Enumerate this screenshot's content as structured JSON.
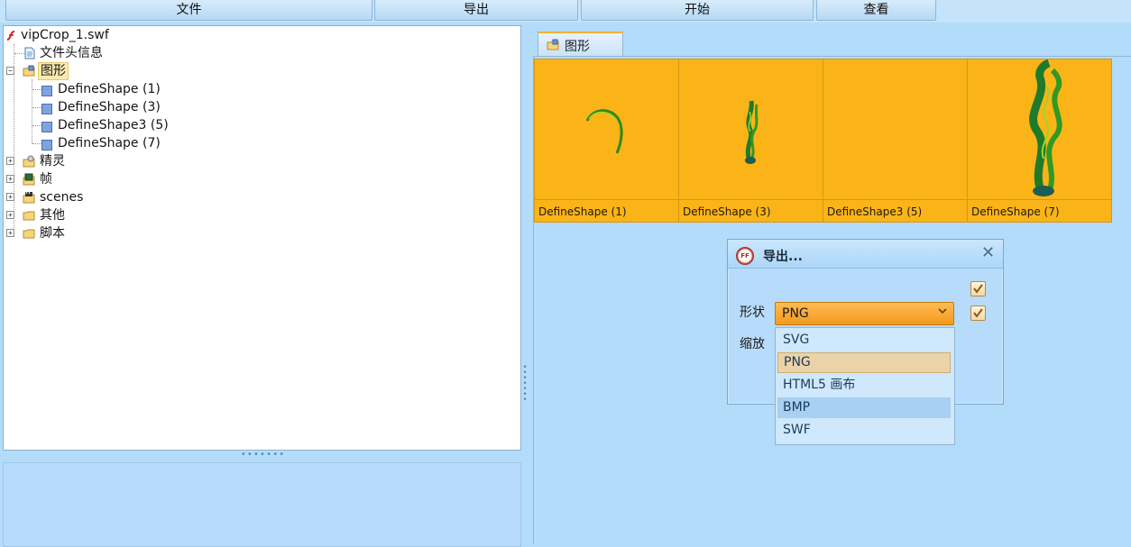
{
  "menu": [
    "文件",
    "导出",
    "开始",
    "查看"
  ],
  "tree": {
    "root": "vipCrop_1.swf",
    "items": {
      "header": "文件头信息",
      "shapes": "图形",
      "shape1": "DefineShape (1)",
      "shape3": "DefineShape (3)",
      "shape5": "DefineShape3 (5)",
      "shape7": "DefineShape (7)",
      "sprites": "精灵",
      "frames": "帧",
      "scenes": "scenes",
      "other": "其他",
      "scripts": "脚本"
    }
  },
  "tab": {
    "label": "图形"
  },
  "thumbnails": [
    "DefineShape (1)",
    "DefineShape (3)",
    "DefineShape3 (5)",
    "DefineShape (7)"
  ],
  "dialog": {
    "title": "导出...",
    "shape_label": "形状",
    "scale_label": "缩放",
    "selected": "PNG",
    "options": [
      "SVG",
      "PNG",
      "HTML5 画布",
      "BMP",
      "SWF"
    ],
    "checkbox1_checked": true,
    "checkbox2_checked": true
  },
  "colors": {
    "background": "#b3dcfb",
    "thumbnail_bg": "#fbb418",
    "combo_accent": "#f39a1c",
    "selection": "#ebd3a9"
  },
  "icons": [
    "flash-file-icon",
    "document-icon",
    "folder-shapes-icon",
    "shape-icon",
    "sprite-folder-icon",
    "frames-icon",
    "scenes-icon",
    "folder-icon",
    "close-icon",
    "chevron-down-icon",
    "checkmark-icon"
  ]
}
